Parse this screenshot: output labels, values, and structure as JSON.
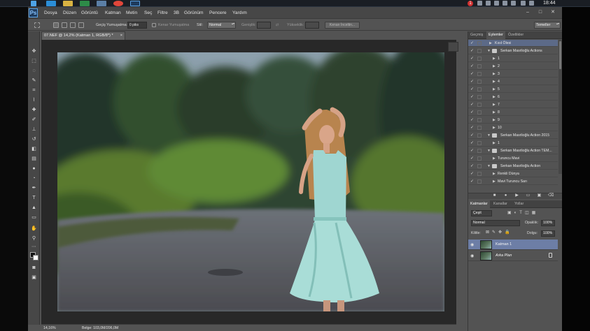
{
  "taskbar": {
    "clock": "18:44",
    "tray_badge": "1",
    "colors": {
      "bar": "#1a1e24",
      "ie": "#2b8ed8",
      "explorer": "#d9b342",
      "excel": "#2d8b48",
      "chrome": "#e0463a",
      "ps": "#1f3c5e"
    }
  },
  "app": {
    "logo": "Ps",
    "menu": [
      "Dosya",
      "Düzen",
      "Görüntü",
      "Katman",
      "Metin",
      "Seç",
      "Filtre",
      "3B",
      "Görünüm",
      "Pencere",
      "Yardım"
    ],
    "window_controls": [
      "–",
      "□",
      "✕"
    ]
  },
  "options": {
    "feather_label": "Geçiş Yumuşatma:",
    "feather_value": "0 piks",
    "antialias_label": "Kenar Yumuşatma",
    "style_label": "Stil:",
    "style_value": "Normal",
    "width_label": "Genişlik:",
    "height_label": "Yükseklik:",
    "refine_button": "Kenarı İnceltin...",
    "workspace": "Temeller"
  },
  "document": {
    "tab_title": "07.NEF @ 14,2% (Katman 1, RGB/8*) *",
    "tab_close": "×",
    "zoom": "14,16%",
    "doc_info": "Belge: 103,0M/206,0M"
  },
  "actions_panel": {
    "tabs": [
      "Geçmiş",
      "Eylemler",
      "Özellikler"
    ],
    "active_tab": 1,
    "rows": [
      {
        "check": "✓",
        "level": 0,
        "type": "action",
        "label": "Kısıl Ölesi",
        "selected": true
      },
      {
        "check": "✓",
        "level": 0,
        "type": "set",
        "label": "Serkan Masrlioğlu Actions"
      },
      {
        "check": "✓",
        "level": 1,
        "type": "action",
        "label": "1"
      },
      {
        "check": "✓",
        "level": 1,
        "type": "action",
        "label": "2"
      },
      {
        "check": "✓",
        "level": 1,
        "type": "action",
        "label": "3"
      },
      {
        "check": "✓",
        "level": 1,
        "type": "action",
        "label": "4"
      },
      {
        "check": "✓",
        "level": 1,
        "type": "action",
        "label": "5"
      },
      {
        "check": "✓",
        "level": 1,
        "type": "action",
        "label": "6"
      },
      {
        "check": "✓",
        "level": 1,
        "type": "action",
        "label": "7"
      },
      {
        "check": "✓",
        "level": 1,
        "type": "action",
        "label": "8"
      },
      {
        "check": "✓",
        "level": 1,
        "type": "action",
        "label": "9"
      },
      {
        "check": "✓",
        "level": 1,
        "type": "action",
        "label": "10"
      },
      {
        "check": "✓",
        "level": 0,
        "type": "set",
        "label": "Serkan Masrlioğlu Action 2015"
      },
      {
        "check": "✓",
        "level": 1,
        "type": "action",
        "label": "1"
      },
      {
        "check": "✓",
        "level": 0,
        "type": "set",
        "label": "Serkan Masrlioğlu Action TEM..."
      },
      {
        "check": "✓",
        "level": 1,
        "type": "action",
        "label": "Turuncu Mavi"
      },
      {
        "check": "✓",
        "level": 0,
        "type": "set",
        "label": "Serkan Masrlioğlu Action"
      },
      {
        "check": "✓",
        "level": 1,
        "type": "action",
        "label": "Renkli Dünya"
      },
      {
        "check": "✓",
        "level": 1,
        "type": "action",
        "label": "Mavi Turuncu Sarı"
      }
    ],
    "footer_icons": [
      "stop-icon",
      "record-icon",
      "play-icon",
      "new-set-icon",
      "new-action-icon",
      "delete-icon"
    ]
  },
  "layers_panel": {
    "tabs": [
      "Katmanlar",
      "Kanallar",
      "Yollar"
    ],
    "active_tab": 0,
    "filter_value": "Çeşit",
    "blend_mode": "Normal",
    "opacity_label": "Opaklık:",
    "opacity_value": "100%",
    "lock_label": "Kilitle:",
    "fill_label": "Dolgu:",
    "fill_value": "100%",
    "layers": [
      {
        "name": "Katman 1",
        "selected": true,
        "visible": true,
        "locked": false
      },
      {
        "name": "Arka Plan",
        "selected": false,
        "visible": true,
        "locked": true
      }
    ]
  }
}
